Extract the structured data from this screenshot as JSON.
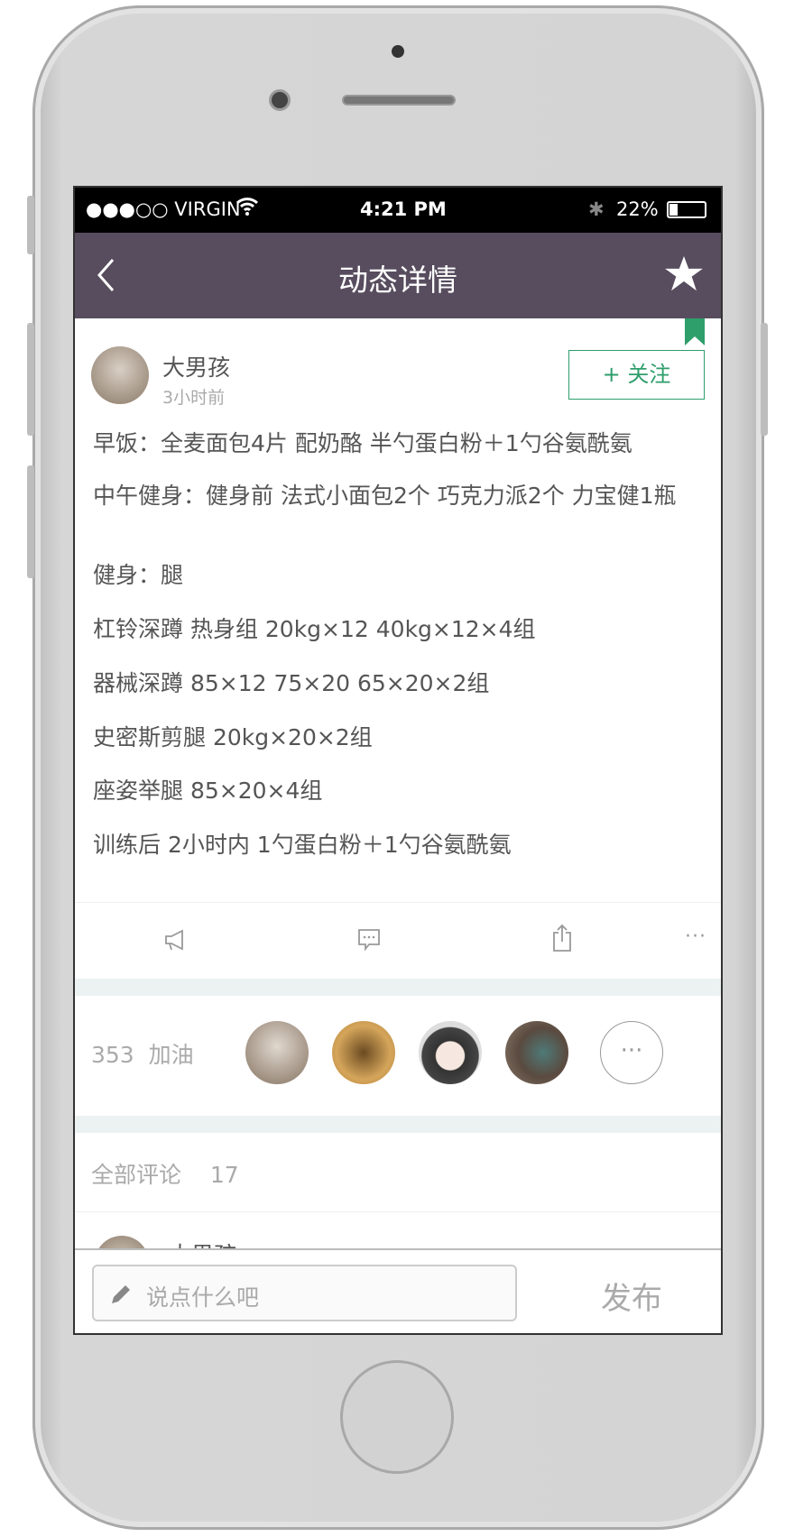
{
  "status_bar": {
    "carrier": "●●●○○ VIRGIN",
    "time": "4:21 PM",
    "battery": "22%"
  },
  "nav": {
    "title": "动态详情",
    "back_icon": "chevron-left",
    "favorite_icon": "star"
  },
  "post": {
    "author": "大男孩",
    "time": "3小时前",
    "follow_label": "+ 关注",
    "lines": [
      "早饭：全麦面包4片 配奶酪  半勺蛋白粉＋1勺谷氨酰氨",
      "中午健身：健身前 法式小面包2个 巧克力派2个 力宝健1瓶",
      "健身：腿",
      "杠铃深蹲 热身组 20kg×12 40kg×12×4组",
      "器械深蹲  85×12 75×20 65×20×2组",
      "史密斯剪腿 20kg×20×2组",
      "座姿举腿 85×20×4组",
      "训练后 2小时内 1勺蛋白粉＋1勺谷氨酰氨"
    ]
  },
  "actions": [
    "megaphone",
    "comment",
    "share",
    "more"
  ],
  "likes": {
    "count": "353",
    "label": "加油"
  },
  "comments": {
    "label": "全部评论",
    "count": "17",
    "first_author": "大男孩"
  },
  "composer": {
    "placeholder": "说点什么吧",
    "submit": "发布"
  },
  "colors": {
    "nav": "#574d5e",
    "accent": "#2e9e6b"
  }
}
